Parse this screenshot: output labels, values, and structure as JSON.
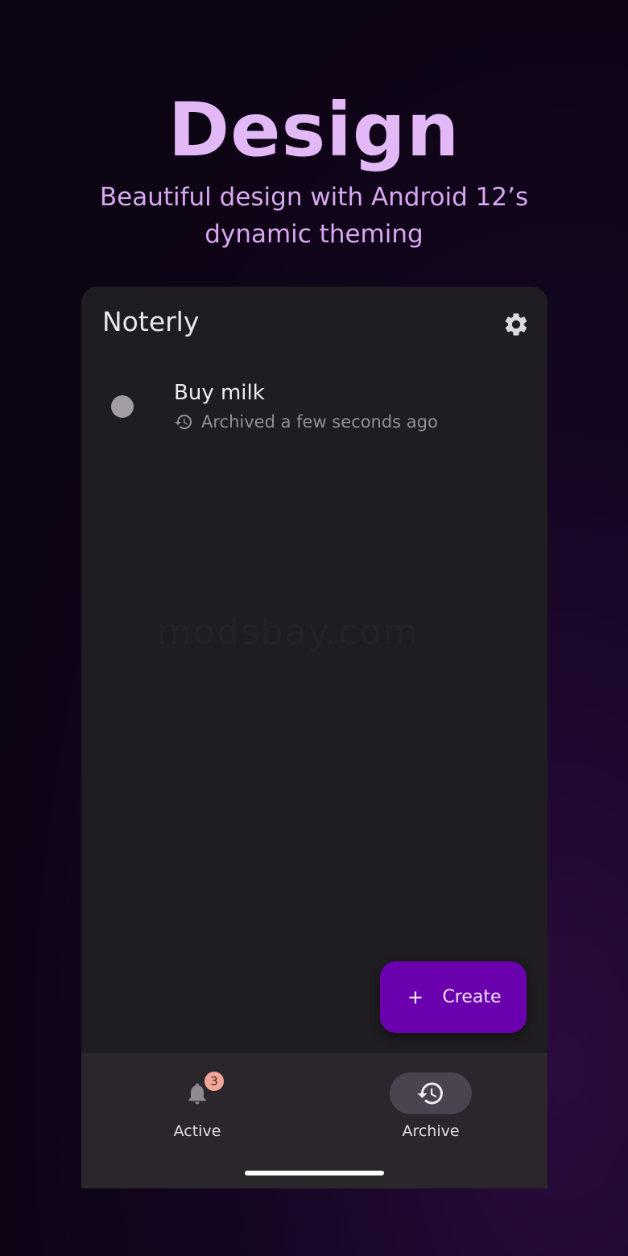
{
  "hero": {
    "title": "Design",
    "subtitle": "Beautiful design with Android 12’s dynamic theming"
  },
  "app": {
    "title": "Noterly",
    "settings_icon": "gear-icon"
  },
  "notes": [
    {
      "title": "Buy milk",
      "meta": "Archived a few seconds ago",
      "meta_icon": "history-icon"
    }
  ],
  "watermark": "modsbay.com",
  "fab": {
    "label": "Create",
    "icon": "plus-icon"
  },
  "nav": {
    "items": [
      {
        "label": "Active",
        "icon": "bell-icon",
        "badge": "3",
        "selected": false
      },
      {
        "label": "Archive",
        "icon": "history-icon",
        "selected": true
      }
    ]
  },
  "colors": {
    "accent": "#6a00ae",
    "hero_text": "#e3b8f7",
    "surface": "#1f1d21",
    "nav_surface": "#2a262c",
    "badge": "#f0a79a"
  }
}
